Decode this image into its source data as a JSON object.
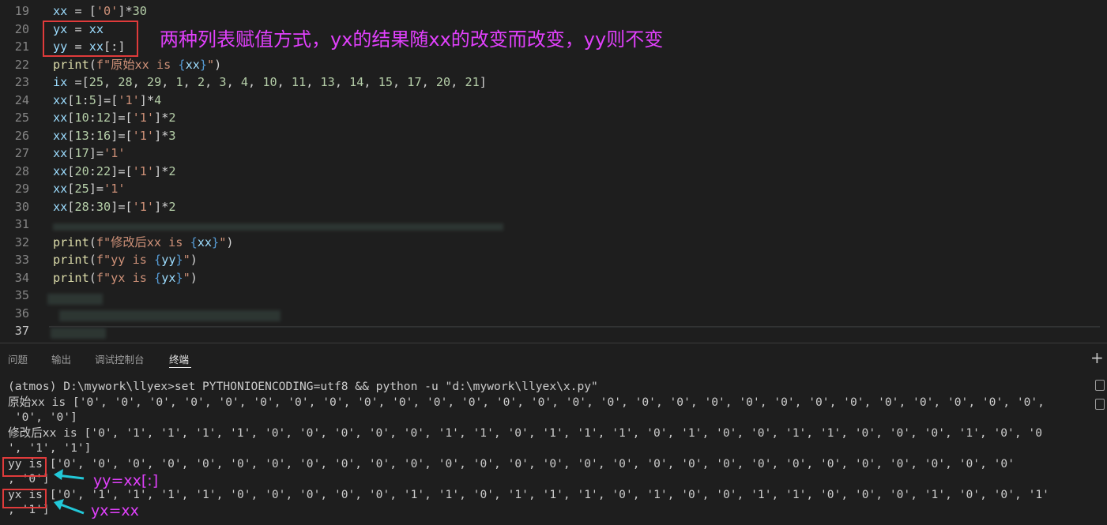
{
  "editor": {
    "lines": [
      {
        "num": "19",
        "tokens": [
          {
            "t": "xx",
            "c": "v"
          },
          {
            "t": " = ["
          },
          {
            "t": "'0'",
            "c": "s"
          },
          {
            "t": "]*"
          },
          {
            "t": "30",
            "c": "n"
          }
        ]
      },
      {
        "num": "20",
        "tokens": [
          {
            "t": "yx",
            "c": "v"
          },
          {
            "t": " = "
          },
          {
            "t": "xx",
            "c": "v"
          }
        ]
      },
      {
        "num": "21",
        "tokens": [
          {
            "t": "yy",
            "c": "v"
          },
          {
            "t": " = "
          },
          {
            "t": "xx",
            "c": "v"
          },
          {
            "t": "[:]"
          }
        ]
      },
      {
        "num": "22",
        "tokens": [
          {
            "t": "print",
            "c": "f"
          },
          {
            "t": "("
          },
          {
            "t": "f\"原始xx is ",
            "c": "s"
          },
          {
            "t": "{",
            "c": "b"
          },
          {
            "t": "xx",
            "c": "v"
          },
          {
            "t": "}",
            "c": "b"
          },
          {
            "t": "\"",
            "c": "s"
          },
          {
            "t": ")"
          }
        ]
      },
      {
        "num": "23",
        "tokens": [
          {
            "t": "ix",
            "c": "v"
          },
          {
            "t": " =["
          },
          {
            "t": "25",
            "c": "n"
          },
          {
            "t": ", "
          },
          {
            "t": "28",
            "c": "n"
          },
          {
            "t": ", "
          },
          {
            "t": "29",
            "c": "n"
          },
          {
            "t": ", "
          },
          {
            "t": "1",
            "c": "n"
          },
          {
            "t": ", "
          },
          {
            "t": "2",
            "c": "n"
          },
          {
            "t": ", "
          },
          {
            "t": "3",
            "c": "n"
          },
          {
            "t": ", "
          },
          {
            "t": "4",
            "c": "n"
          },
          {
            "t": ", "
          },
          {
            "t": "10",
            "c": "n"
          },
          {
            "t": ", "
          },
          {
            "t": "11",
            "c": "n"
          },
          {
            "t": ", "
          },
          {
            "t": "13",
            "c": "n"
          },
          {
            "t": ", "
          },
          {
            "t": "14",
            "c": "n"
          },
          {
            "t": ", "
          },
          {
            "t": "15",
            "c": "n"
          },
          {
            "t": ", "
          },
          {
            "t": "17",
            "c": "n"
          },
          {
            "t": ", "
          },
          {
            "t": "20",
            "c": "n"
          },
          {
            "t": ", "
          },
          {
            "t": "21",
            "c": "n"
          },
          {
            "t": "]"
          }
        ]
      },
      {
        "num": "24",
        "tokens": [
          {
            "t": "xx",
            "c": "v"
          },
          {
            "t": "["
          },
          {
            "t": "1",
            "c": "n"
          },
          {
            "t": ":"
          },
          {
            "t": "5",
            "c": "n"
          },
          {
            "t": "]=["
          },
          {
            "t": "'1'",
            "c": "s"
          },
          {
            "t": "]*"
          },
          {
            "t": "4",
            "c": "n"
          }
        ]
      },
      {
        "num": "25",
        "tokens": [
          {
            "t": "xx",
            "c": "v"
          },
          {
            "t": "["
          },
          {
            "t": "10",
            "c": "n"
          },
          {
            "t": ":"
          },
          {
            "t": "12",
            "c": "n"
          },
          {
            "t": "]=["
          },
          {
            "t": "'1'",
            "c": "s"
          },
          {
            "t": "]*"
          },
          {
            "t": "2",
            "c": "n"
          }
        ]
      },
      {
        "num": "26",
        "tokens": [
          {
            "t": "xx",
            "c": "v"
          },
          {
            "t": "["
          },
          {
            "t": "13",
            "c": "n"
          },
          {
            "t": ":"
          },
          {
            "t": "16",
            "c": "n"
          },
          {
            "t": "]=["
          },
          {
            "t": "'1'",
            "c": "s"
          },
          {
            "t": "]*"
          },
          {
            "t": "3",
            "c": "n"
          }
        ]
      },
      {
        "num": "27",
        "tokens": [
          {
            "t": "xx",
            "c": "v"
          },
          {
            "t": "["
          },
          {
            "t": "17",
            "c": "n"
          },
          {
            "t": "]="
          },
          {
            "t": "'1'",
            "c": "s"
          }
        ]
      },
      {
        "num": "28",
        "tokens": [
          {
            "t": "xx",
            "c": "v"
          },
          {
            "t": "["
          },
          {
            "t": "20",
            "c": "n"
          },
          {
            "t": ":"
          },
          {
            "t": "22",
            "c": "n"
          },
          {
            "t": "]=["
          },
          {
            "t": "'1'",
            "c": "s"
          },
          {
            "t": "]*"
          },
          {
            "t": "2",
            "c": "n"
          }
        ]
      },
      {
        "num": "29",
        "tokens": [
          {
            "t": "xx",
            "c": "v"
          },
          {
            "t": "["
          },
          {
            "t": "25",
            "c": "n"
          },
          {
            "t": "]="
          },
          {
            "t": "'1'",
            "c": "s"
          }
        ]
      },
      {
        "num": "30",
        "tokens": [
          {
            "t": "xx",
            "c": "v"
          },
          {
            "t": "["
          },
          {
            "t": "28",
            "c": "n"
          },
          {
            "t": ":"
          },
          {
            "t": "30",
            "c": "n"
          },
          {
            "t": "]=["
          },
          {
            "t": "'1'",
            "c": "s"
          },
          {
            "t": "]*"
          },
          {
            "t": "2",
            "c": "n"
          }
        ]
      },
      {
        "num": "31",
        "tokens": []
      },
      {
        "num": "32",
        "tokens": [
          {
            "t": "print",
            "c": "f"
          },
          {
            "t": "("
          },
          {
            "t": "f\"修改后xx is ",
            "c": "s"
          },
          {
            "t": "{",
            "c": "b"
          },
          {
            "t": "xx",
            "c": "v"
          },
          {
            "t": "}",
            "c": "b"
          },
          {
            "t": "\"",
            "c": "s"
          },
          {
            "t": ")"
          }
        ]
      },
      {
        "num": "33",
        "tokens": [
          {
            "t": "print",
            "c": "f"
          },
          {
            "t": "("
          },
          {
            "t": "f\"yy is ",
            "c": "s"
          },
          {
            "t": "{",
            "c": "b"
          },
          {
            "t": "yy",
            "c": "v"
          },
          {
            "t": "}",
            "c": "b"
          },
          {
            "t": "\"",
            "c": "s"
          },
          {
            "t": ")"
          }
        ]
      },
      {
        "num": "34",
        "tokens": [
          {
            "t": "print",
            "c": "f"
          },
          {
            "t": "("
          },
          {
            "t": "f\"yx is ",
            "c": "s"
          },
          {
            "t": "{",
            "c": "b"
          },
          {
            "t": "yx",
            "c": "v"
          },
          {
            "t": "}",
            "c": "b"
          },
          {
            "t": "\"",
            "c": "s"
          },
          {
            "t": ")"
          }
        ]
      },
      {
        "num": "35",
        "tokens": []
      },
      {
        "num": "36",
        "tokens": []
      },
      {
        "num": "37",
        "tokens": []
      }
    ],
    "annotation": "两种列表赋值方式，yx的结果随xx的改变而改变，yy则不变"
  },
  "panel": {
    "tabs": [
      {
        "label": "问题",
        "active": false
      },
      {
        "label": "输出",
        "active": false
      },
      {
        "label": "调试控制台",
        "active": false
      },
      {
        "label": "终端",
        "active": true
      }
    ],
    "add_label": "+",
    "terminal_lines": [
      "(atmos) D:\\mywork\\llyex>set PYTHONIOENCODING=utf8 && python -u \"d:\\mywork\\llyex\\x.py\"",
      "原始xx is ['0', '0', '0', '0', '0', '0', '0', '0', '0', '0', '0', '0', '0', '0', '0', '0', '0', '0', '0', '0', '0', '0', '0', '0', '0', '0', '0', '0',",
      " '0', '0']",
      "修改后xx is ['0', '1', '1', '1', '1', '0', '0', '0', '0', '0', '1', '1', '0', '1', '1', '1', '0', '1', '0', '0', '1', '1', '0', '0', '0', '1', '0', '0",
      "', '1', '1']",
      "yy is ['0', '0', '0', '0', '0', '0', '0', '0', '0', '0', '0', '0', '0', '0', '0', '0', '0', '0', '0', '0', '0', '0', '0', '0', '0', '0', '0', '0'",
      ", '0']",
      "yx is ['0', '1', '1', '1', '1', '0', '0', '0', '0', '0', '1', '1', '0', '1', '1', '1', '0', '1', '0', '0', '1', '1', '0', '0', '0', '1', '0', '0', '1'",
      ", '1']"
    ],
    "annotations": {
      "yy_note": "yy=xx[:]",
      "yx_note": "yx=xx"
    },
    "colors": {
      "highlight_box": "#e03b3b",
      "annotation_text": "#e040fb",
      "arrow": "#22c8d8"
    }
  }
}
